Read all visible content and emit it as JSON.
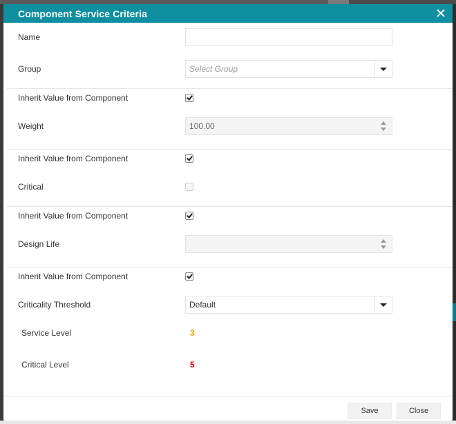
{
  "dialog": {
    "title": "Component Service Criteria"
  },
  "form": {
    "name_label": "Name",
    "name_value": "",
    "group_label": "Group",
    "group_placeholder": "Select Group",
    "inherit_label_1": "Inherit Value from Component",
    "inherit_checked_1": true,
    "weight_label": "Weight",
    "weight_value": "100.00",
    "inherit_label_2": "Inherit Value from Component",
    "inherit_checked_2": true,
    "critical_label": "Critical",
    "critical_checked": false,
    "inherit_label_3": "Inherit Value from Component",
    "inherit_checked_3": true,
    "design_life_label": "Design Life",
    "design_life_value": "",
    "inherit_label_4": "Inherit Value from Component",
    "inherit_checked_4": true,
    "criticality_threshold_label": "Criticality Threshold",
    "criticality_threshold_value": "Default",
    "service_level_label": "Service Level",
    "service_level_value": "3",
    "critical_level_label": "Critical Level",
    "critical_level_value": "5"
  },
  "colors": {
    "header": "#0f8fa0",
    "service_level": "#f0a000",
    "critical_level": "#e00000"
  },
  "footer": {
    "save_label": "Save",
    "close_label": "Close"
  }
}
